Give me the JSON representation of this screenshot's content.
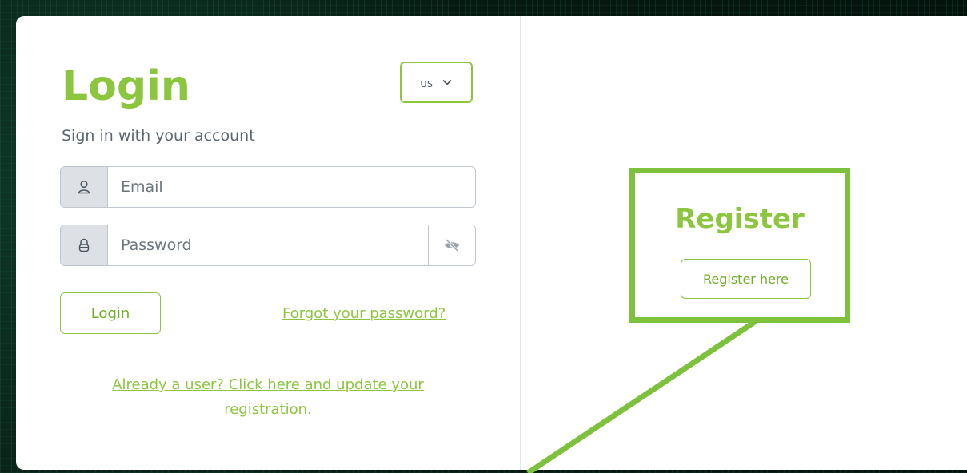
{
  "login": {
    "title": "Login",
    "subtitle": "Sign in with your account",
    "email_placeholder": "Email",
    "password_placeholder": "Password",
    "login_button": "Login",
    "forgot_link": "Forgot your password?",
    "already_user_link": "Already a user? Click here and update your registration."
  },
  "language": {
    "selected": "US"
  },
  "register": {
    "title": "Register",
    "button": "Register here"
  },
  "icons": {
    "email": "user-icon",
    "password": "lock-icon",
    "password_toggle": "eye-slash-icon",
    "language_dropdown": "chevron-down-icon"
  },
  "colors": {
    "accent": "#8cc63f",
    "highlight": "#7dc13c"
  }
}
